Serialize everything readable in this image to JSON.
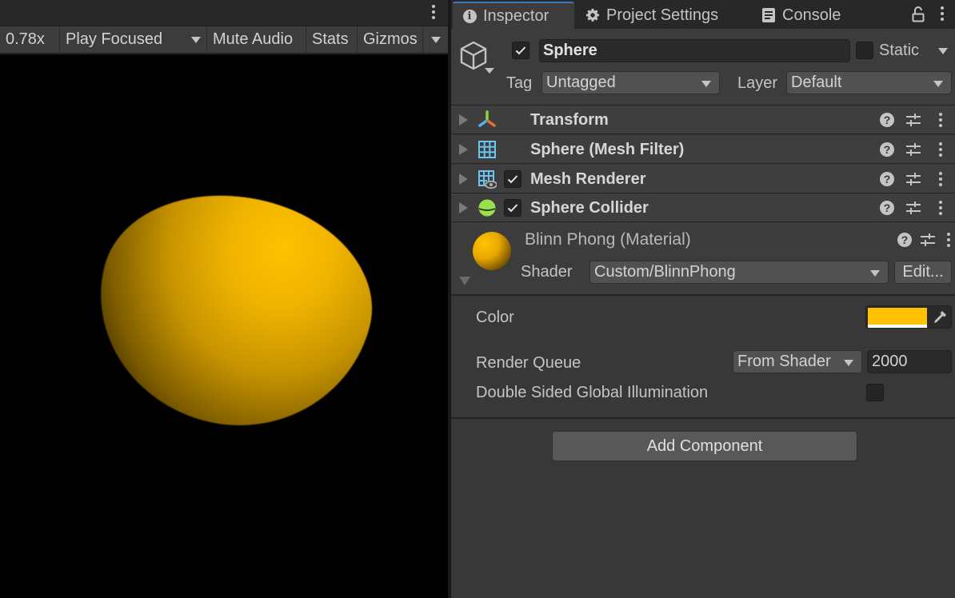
{
  "game_view": {
    "toolbar": {
      "scale": "0.78x",
      "play_mode": "Play Focused",
      "mute_audio": "Mute Audio",
      "stats": "Stats",
      "gizmos": "Gizmos"
    },
    "object_color": "#ffc200"
  },
  "inspector": {
    "tabs": [
      {
        "label": "Inspector",
        "icon": "info-icon",
        "active": true
      },
      {
        "label": "Project Settings",
        "icon": "gear-icon",
        "active": false
      },
      {
        "label": "Console",
        "icon": "console-icon",
        "active": false
      }
    ],
    "header": {
      "active": true,
      "name": "Sphere",
      "static_label": "Static",
      "static": false,
      "tag_label": "Tag",
      "tag_value": "Untagged",
      "layer_label": "Layer",
      "layer_value": "Default"
    },
    "components": [
      {
        "name": "Transform",
        "icon": "transform-icon",
        "has_toggle": false
      },
      {
        "name": "Sphere (Mesh Filter)",
        "icon": "mesh-filter-icon",
        "has_toggle": false
      },
      {
        "name": "Mesh Renderer",
        "icon": "mesh-renderer-icon",
        "has_toggle": true,
        "enabled": true
      },
      {
        "name": "Sphere Collider",
        "icon": "sphere-collider-icon",
        "has_toggle": true,
        "enabled": true
      }
    ],
    "material": {
      "name": "Blinn Phong (Material)",
      "shader_label": "Shader",
      "shader_value": "Custom/BlinnPhong",
      "edit_label": "Edit..."
    },
    "properties": {
      "color_label": "Color",
      "color_value": "#ffc200",
      "render_queue_label": "Render Queue",
      "render_queue_mode": "From Shader",
      "render_queue_value": "2000",
      "dsgi_label": "Double Sided Global Illumination",
      "dsgi_value": false
    },
    "add_component_label": "Add Component",
    "accent_color": "#3a79bb"
  }
}
